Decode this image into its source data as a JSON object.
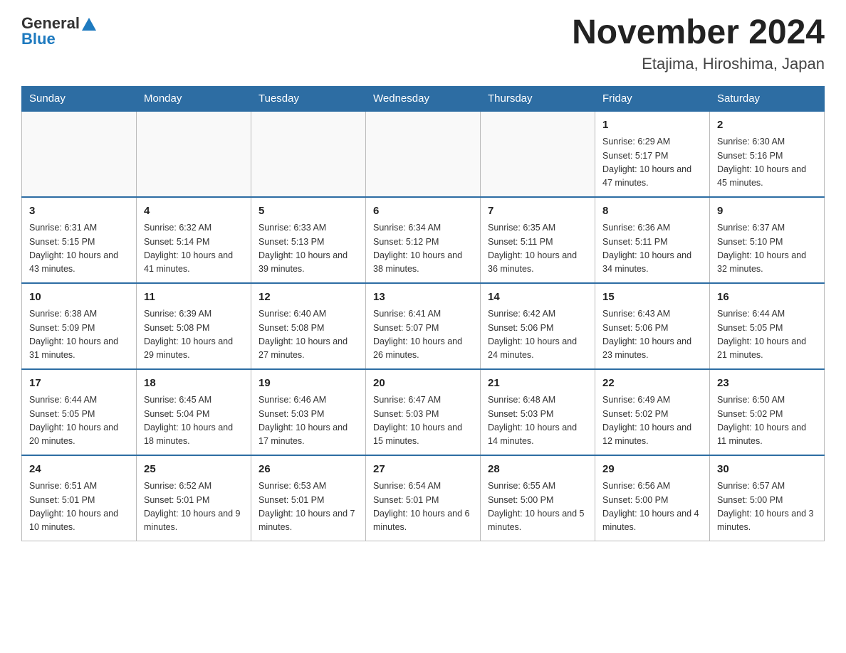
{
  "header": {
    "logo_general": "General",
    "logo_blue": "Blue",
    "month_title": "November 2024",
    "location": "Etajima, Hiroshima, Japan"
  },
  "weekdays": [
    "Sunday",
    "Monday",
    "Tuesday",
    "Wednesday",
    "Thursday",
    "Friday",
    "Saturday"
  ],
  "weeks": [
    [
      {
        "day": "",
        "info": ""
      },
      {
        "day": "",
        "info": ""
      },
      {
        "day": "",
        "info": ""
      },
      {
        "day": "",
        "info": ""
      },
      {
        "day": "",
        "info": ""
      },
      {
        "day": "1",
        "info": "Sunrise: 6:29 AM\nSunset: 5:17 PM\nDaylight: 10 hours and 47 minutes."
      },
      {
        "day": "2",
        "info": "Sunrise: 6:30 AM\nSunset: 5:16 PM\nDaylight: 10 hours and 45 minutes."
      }
    ],
    [
      {
        "day": "3",
        "info": "Sunrise: 6:31 AM\nSunset: 5:15 PM\nDaylight: 10 hours and 43 minutes."
      },
      {
        "day": "4",
        "info": "Sunrise: 6:32 AM\nSunset: 5:14 PM\nDaylight: 10 hours and 41 minutes."
      },
      {
        "day": "5",
        "info": "Sunrise: 6:33 AM\nSunset: 5:13 PM\nDaylight: 10 hours and 39 minutes."
      },
      {
        "day": "6",
        "info": "Sunrise: 6:34 AM\nSunset: 5:12 PM\nDaylight: 10 hours and 38 minutes."
      },
      {
        "day": "7",
        "info": "Sunrise: 6:35 AM\nSunset: 5:11 PM\nDaylight: 10 hours and 36 minutes."
      },
      {
        "day": "8",
        "info": "Sunrise: 6:36 AM\nSunset: 5:11 PM\nDaylight: 10 hours and 34 minutes."
      },
      {
        "day": "9",
        "info": "Sunrise: 6:37 AM\nSunset: 5:10 PM\nDaylight: 10 hours and 32 minutes."
      }
    ],
    [
      {
        "day": "10",
        "info": "Sunrise: 6:38 AM\nSunset: 5:09 PM\nDaylight: 10 hours and 31 minutes."
      },
      {
        "day": "11",
        "info": "Sunrise: 6:39 AM\nSunset: 5:08 PM\nDaylight: 10 hours and 29 minutes."
      },
      {
        "day": "12",
        "info": "Sunrise: 6:40 AM\nSunset: 5:08 PM\nDaylight: 10 hours and 27 minutes."
      },
      {
        "day": "13",
        "info": "Sunrise: 6:41 AM\nSunset: 5:07 PM\nDaylight: 10 hours and 26 minutes."
      },
      {
        "day": "14",
        "info": "Sunrise: 6:42 AM\nSunset: 5:06 PM\nDaylight: 10 hours and 24 minutes."
      },
      {
        "day": "15",
        "info": "Sunrise: 6:43 AM\nSunset: 5:06 PM\nDaylight: 10 hours and 23 minutes."
      },
      {
        "day": "16",
        "info": "Sunrise: 6:44 AM\nSunset: 5:05 PM\nDaylight: 10 hours and 21 minutes."
      }
    ],
    [
      {
        "day": "17",
        "info": "Sunrise: 6:44 AM\nSunset: 5:05 PM\nDaylight: 10 hours and 20 minutes."
      },
      {
        "day": "18",
        "info": "Sunrise: 6:45 AM\nSunset: 5:04 PM\nDaylight: 10 hours and 18 minutes."
      },
      {
        "day": "19",
        "info": "Sunrise: 6:46 AM\nSunset: 5:03 PM\nDaylight: 10 hours and 17 minutes."
      },
      {
        "day": "20",
        "info": "Sunrise: 6:47 AM\nSunset: 5:03 PM\nDaylight: 10 hours and 15 minutes."
      },
      {
        "day": "21",
        "info": "Sunrise: 6:48 AM\nSunset: 5:03 PM\nDaylight: 10 hours and 14 minutes."
      },
      {
        "day": "22",
        "info": "Sunrise: 6:49 AM\nSunset: 5:02 PM\nDaylight: 10 hours and 12 minutes."
      },
      {
        "day": "23",
        "info": "Sunrise: 6:50 AM\nSunset: 5:02 PM\nDaylight: 10 hours and 11 minutes."
      }
    ],
    [
      {
        "day": "24",
        "info": "Sunrise: 6:51 AM\nSunset: 5:01 PM\nDaylight: 10 hours and 10 minutes."
      },
      {
        "day": "25",
        "info": "Sunrise: 6:52 AM\nSunset: 5:01 PM\nDaylight: 10 hours and 9 minutes."
      },
      {
        "day": "26",
        "info": "Sunrise: 6:53 AM\nSunset: 5:01 PM\nDaylight: 10 hours and 7 minutes."
      },
      {
        "day": "27",
        "info": "Sunrise: 6:54 AM\nSunset: 5:01 PM\nDaylight: 10 hours and 6 minutes."
      },
      {
        "day": "28",
        "info": "Sunrise: 6:55 AM\nSunset: 5:00 PM\nDaylight: 10 hours and 5 minutes."
      },
      {
        "day": "29",
        "info": "Sunrise: 6:56 AM\nSunset: 5:00 PM\nDaylight: 10 hours and 4 minutes."
      },
      {
        "day": "30",
        "info": "Sunrise: 6:57 AM\nSunset: 5:00 PM\nDaylight: 10 hours and 3 minutes."
      }
    ]
  ]
}
